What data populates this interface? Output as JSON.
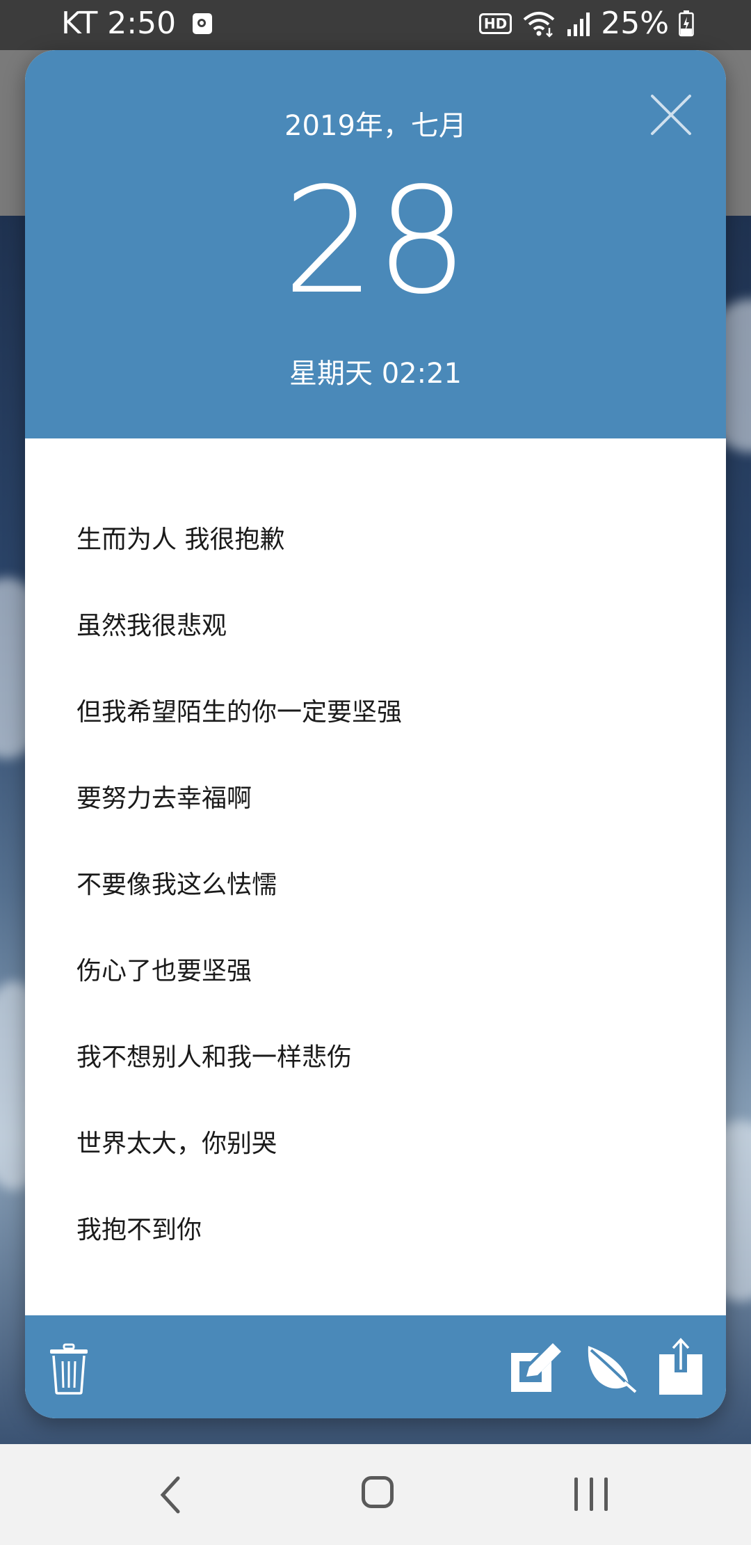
{
  "status_bar": {
    "carrier_time": "KT 2:50",
    "hd_label": "HD",
    "battery": "25%"
  },
  "dialog": {
    "month_year": "2019年，七月",
    "day": "28",
    "weekday_time": "星期天 02:21",
    "lines": [
      "生而为人 我很抱歉",
      "虽然我很悲观",
      "但我希望陌生的你一定要坚强",
      "要努力去幸福啊",
      "不要像我这么怯懦",
      "伤心了也要坚强",
      "我不想别人和我一样悲伤",
      "世界太大，你别哭",
      "我抱不到你"
    ]
  },
  "colors": {
    "accent": "#4a89b9",
    "status_bar": "#3c3c3c",
    "nav_bar": "#f2f2f2"
  },
  "icons": {
    "close": "close-icon",
    "trash": "trash-icon",
    "edit": "edit-icon",
    "leaf": "leaf-icon",
    "share": "share-icon"
  }
}
